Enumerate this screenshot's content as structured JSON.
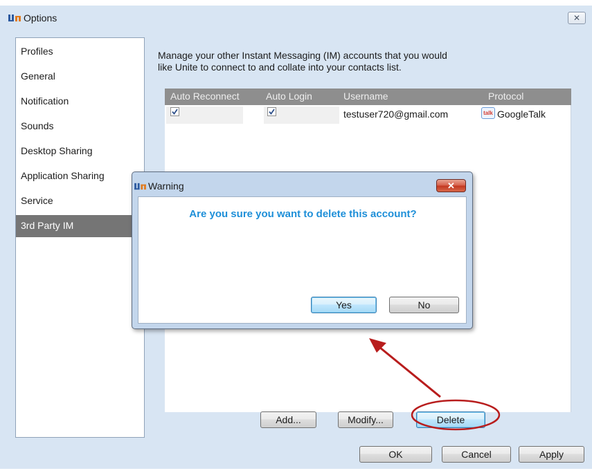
{
  "window": {
    "title": "Options",
    "close_label": "X"
  },
  "nav": {
    "items": [
      {
        "label": "Profiles"
      },
      {
        "label": "General"
      },
      {
        "label": "Notification"
      },
      {
        "label": "Sounds"
      },
      {
        "label": "Desktop Sharing"
      },
      {
        "label": "Application  Sharing"
      },
      {
        "label": "Service"
      },
      {
        "label": "3rd Party IM"
      }
    ],
    "selected": "3rd Party IM"
  },
  "content": {
    "description_line1": "Manage your other Instant Messaging (IM) accounts that you would",
    "description_line2": "like Unite to connect to and collate into your contacts list.",
    "columns": [
      "Auto Reconnect",
      "Auto Login",
      "Username",
      "Protocol"
    ],
    "rows": [
      {
        "auto_reconnect": true,
        "auto_login": true,
        "username": "testuser720@gmail.com",
        "protocol": "GoogleTalk",
        "protocol_icon": "google-talk-icon"
      }
    ],
    "buttons": {
      "add": "Add...",
      "modify": "Modify...",
      "delete": "Delete"
    }
  },
  "footer": {
    "ok": "OK",
    "cancel": "Cancel",
    "apply": "Apply"
  },
  "dialog": {
    "title": "Warning",
    "message": "Are you sure you want to delete this account?",
    "yes": "Yes",
    "no": "No"
  },
  "colors": {
    "window_bg": "#d8e5f3",
    "selected_nav": "#757575",
    "table_header": "#8e8e8e",
    "dialog_message": "#1e8fd8",
    "annotation_red": "#b81d1d"
  }
}
